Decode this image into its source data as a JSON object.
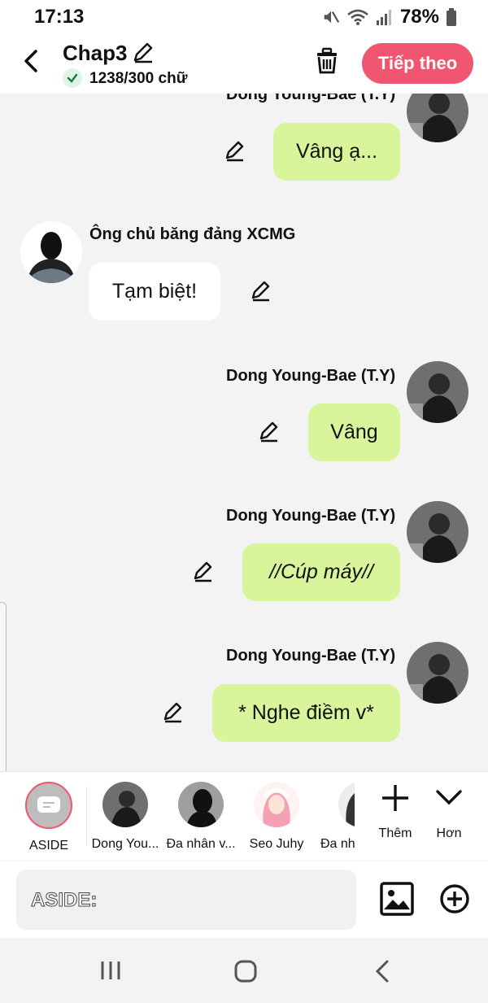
{
  "status_bar": {
    "time": "17:13",
    "battery": "78%"
  },
  "header": {
    "title": "Chap3",
    "word_count": "1238/300 chữ",
    "next_label": "Tiếp theo"
  },
  "messages": [
    {
      "sender": "Dong Young-Bae (T.Y)",
      "text": "Vâng ạ...",
      "side": "right"
    },
    {
      "sender": "Ông chủ băng đảng XCMG",
      "text": "Tạm biệt!",
      "side": "left"
    },
    {
      "sender": "Dong Young-Bae (T.Y)",
      "text": "Vâng",
      "side": "right"
    },
    {
      "sender": "Dong Young-Bae (T.Y)",
      "text": "//Cúp máy//",
      "side": "right"
    },
    {
      "sender": "Dong Young-Bae (T.Y)",
      "text": "* Nghe điềm v*",
      "side": "right"
    }
  ],
  "characters": [
    {
      "label": "ASIDE"
    },
    {
      "label": "Dong You..."
    },
    {
      "label": "Đa nhân v..."
    },
    {
      "label": "Seo Juhy"
    },
    {
      "label": "Đa nh"
    }
  ],
  "tools": {
    "add_label": "Thêm",
    "more_label": "Hơn"
  },
  "composer": {
    "placeholder": "ASIDE:"
  },
  "colors": {
    "accent": "#f0566f",
    "my_bubble": "#d9f59b",
    "other_bubble": "#ffffff"
  }
}
